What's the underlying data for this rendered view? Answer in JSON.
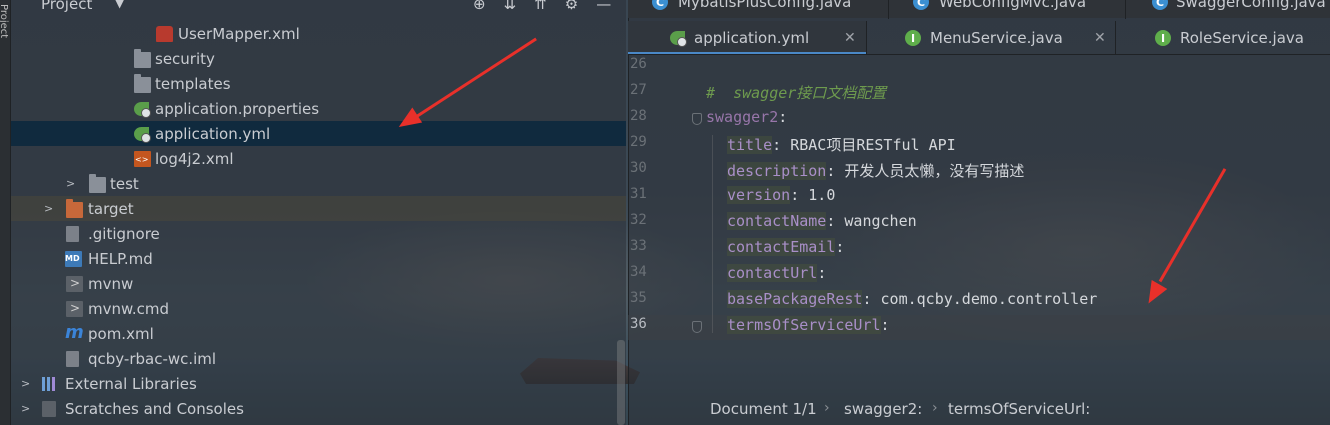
{
  "project_panel": {
    "title": "Project",
    "side_label": "Project"
  },
  "tree": [
    {
      "label": "UserMapper.xml",
      "icon": "mapper-xml-icon"
    },
    {
      "label": "security",
      "icon": "folder-icon"
    },
    {
      "label": "templates",
      "icon": "folder-icon"
    },
    {
      "label": "application.properties",
      "icon": "spring-config-icon"
    },
    {
      "label": "application.yml",
      "icon": "spring-config-icon"
    },
    {
      "label": "log4j2.xml",
      "icon": "xml-file-icon"
    },
    {
      "label": "test",
      "icon": "folder-icon"
    },
    {
      "label": "target",
      "icon": "folder-icon"
    },
    {
      "label": ".gitignore",
      "icon": "file-icon"
    },
    {
      "label": "HELP.md",
      "icon": "markdown-icon"
    },
    {
      "label": "mvnw",
      "icon": "shell-file-icon"
    },
    {
      "label": "mvnw.cmd",
      "icon": "cmd-file-icon"
    },
    {
      "label": "pom.xml",
      "icon": "maven-icon"
    },
    {
      "label": "qcby-rbac-wc.iml",
      "icon": "iml-file-icon"
    },
    {
      "label": "External Libraries",
      "icon": "libraries-icon"
    },
    {
      "label": "Scratches and Consoles",
      "icon": "scratches-icon"
    }
  ],
  "tabs_row1": [
    {
      "label": "MybatisPlusConfig.java",
      "icon": "C"
    },
    {
      "label": "WebConfigMvc.java",
      "icon": "C"
    },
    {
      "label": "SwaggerConfig.java",
      "icon": "C"
    }
  ],
  "tabs_row2": [
    {
      "label": "application.yml",
      "icon": "spring-config-icon",
      "active": true
    },
    {
      "label": "MenuService.java",
      "icon": "I"
    },
    {
      "label": "RoleService.java",
      "icon": "I"
    }
  ],
  "editor": {
    "line_numbers": [
      "26",
      "27",
      "28",
      "29",
      "30",
      "31",
      "32",
      "33",
      "34",
      "35",
      "36"
    ],
    "lines": [
      {
        "comment": ""
      },
      {
        "comment": "#  swagger接口文档配置"
      },
      {
        "key": "swagger2",
        "sep": ":",
        "value": ""
      },
      {
        "key": "title",
        "sep": ": ",
        "value": "RBAC项目RESTful API"
      },
      {
        "key": "description",
        "sep": ": ",
        "value": "开发人员太懒，没有写描述"
      },
      {
        "key": "version",
        "sep": ": ",
        "value": "1.0"
      },
      {
        "key": "contactName",
        "sep": ": ",
        "value": "wangchen"
      },
      {
        "key": "contactEmail",
        "sep": ":",
        "value": ""
      },
      {
        "key": "contactUrl",
        "sep": ":",
        "value": ""
      },
      {
        "key": "basePackageRest",
        "sep": ": ",
        "value": "com.qcby.demo.controller"
      },
      {
        "key": "termsOfServiceUrl",
        "sep": ":",
        "value": ""
      }
    ]
  },
  "statusbar": {
    "document": "Document 1/1",
    "crumb1": "swagger2:",
    "crumb2": "termsOfServiceUrl:"
  },
  "colors": {
    "arrow": "#e8302a",
    "selection": "#0d293e",
    "key": "#9876aa",
    "comment": "#6e9b4e"
  }
}
